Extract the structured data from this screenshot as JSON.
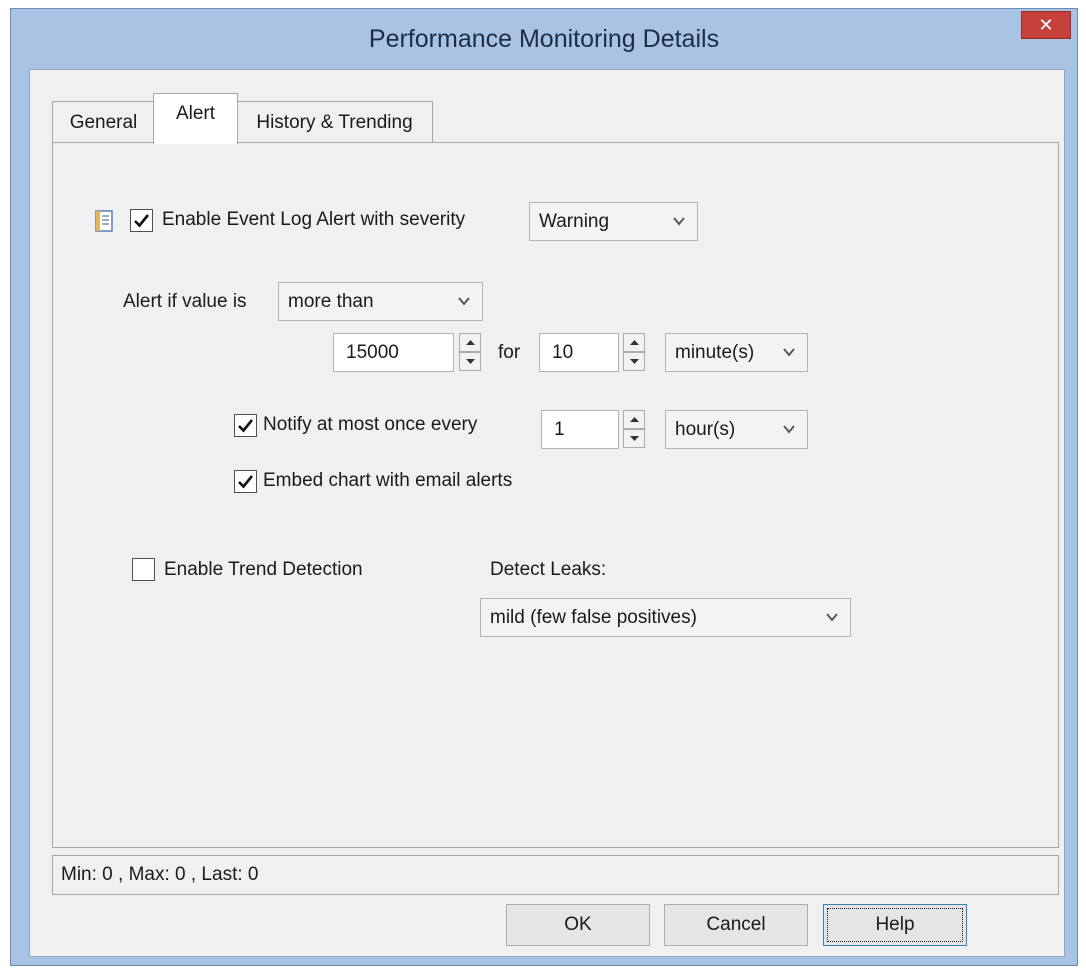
{
  "window": {
    "title": "Performance Monitoring Details",
    "close_icon": "close-icon"
  },
  "tabs": [
    {
      "label": "General",
      "active": false
    },
    {
      "label": "Alert",
      "active": true
    },
    {
      "label": "History & Trending",
      "active": false
    }
  ],
  "alert": {
    "event_log": {
      "icon": "event-log-icon",
      "label": "Enable Event Log Alert with severity",
      "checked": true,
      "severity": "Warning"
    },
    "condition": {
      "label": "Alert if value is",
      "operator": "more than",
      "threshold": "15000",
      "for_label": "for",
      "duration": "10",
      "duration_unit": "minute(s)"
    },
    "notify": {
      "label": "Notify at most once every",
      "checked": true,
      "interval": "1",
      "interval_unit": "hour(s)"
    },
    "embed_chart": {
      "label": "Embed chart with email alerts",
      "checked": true
    },
    "trend": {
      "label": "Enable Trend Detection",
      "checked": false
    },
    "leaks": {
      "label": "Detect Leaks:",
      "value": "mild (few false positives)"
    }
  },
  "status": {
    "text": "Min: 0 , Max: 0 , Last: 0"
  },
  "buttons": {
    "ok": "OK",
    "cancel": "Cancel",
    "help": "Help"
  },
  "colors": {
    "frame": "#a9c3e4",
    "close_button": "#c7413b",
    "dialog_bg": "#f0f0f0"
  }
}
